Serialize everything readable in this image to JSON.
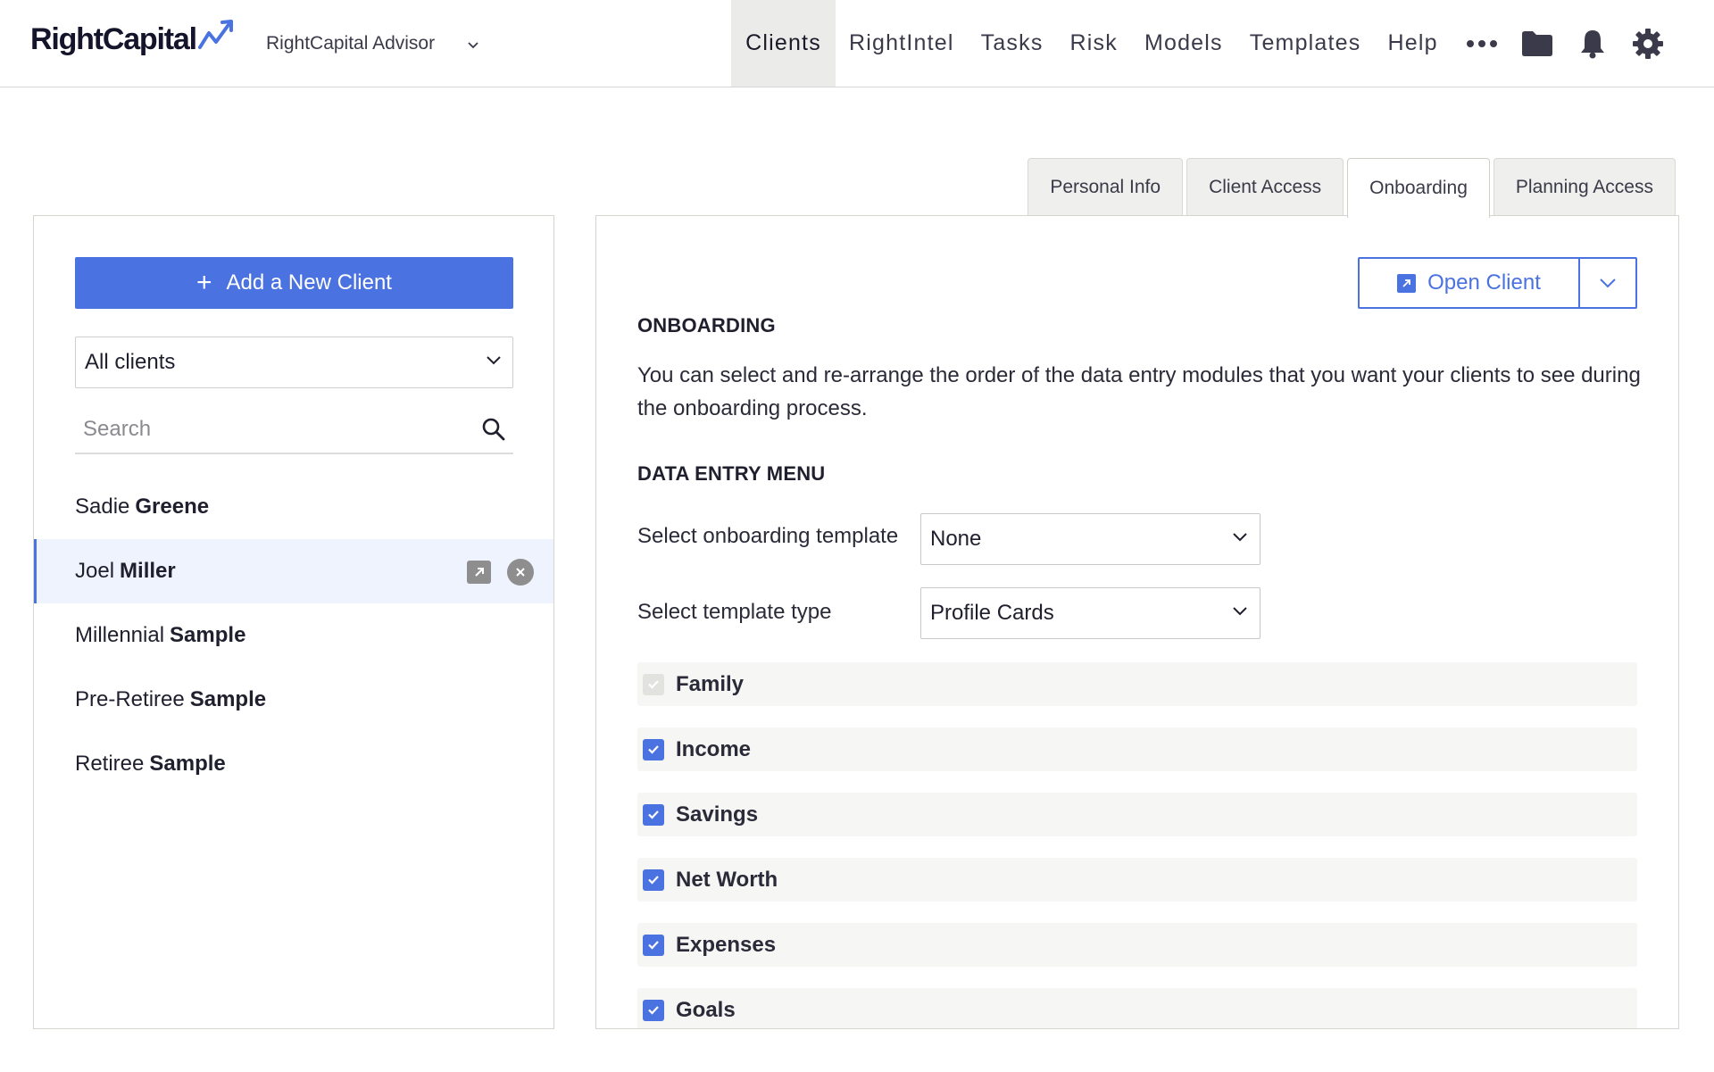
{
  "app": {
    "logo_text": "RightCapital",
    "advisor_name": "RightCapital Advisor"
  },
  "nav": {
    "items": [
      {
        "label": "Clients",
        "active": true
      },
      {
        "label": "RightIntel",
        "active": false
      },
      {
        "label": "Tasks",
        "active": false
      },
      {
        "label": "Risk",
        "active": false
      },
      {
        "label": "Models",
        "active": false
      },
      {
        "label": "Templates",
        "active": false
      },
      {
        "label": "Help",
        "active": false
      }
    ],
    "icons": [
      "more-icon",
      "folder-icon",
      "bell-icon",
      "gear-icon"
    ]
  },
  "tabs": [
    {
      "label": "Personal Info",
      "active": false
    },
    {
      "label": "Client Access",
      "active": false
    },
    {
      "label": "Onboarding",
      "active": true
    },
    {
      "label": "Planning Access",
      "active": false
    }
  ],
  "sidebar": {
    "add_button_label": "Add a New Client",
    "filter_value": "All clients",
    "search_placeholder": "Search",
    "clients": [
      {
        "first": "Sadie",
        "last": "Greene",
        "selected": false
      },
      {
        "first": "Joel",
        "last": "Miller",
        "selected": true
      },
      {
        "first": "Millennial",
        "last": "Sample",
        "selected": false
      },
      {
        "first": "Pre-Retiree",
        "last": "Sample",
        "selected": false
      },
      {
        "first": "Retiree",
        "last": "Sample",
        "selected": false
      }
    ]
  },
  "main": {
    "open_client_label": "Open Client",
    "onboarding_heading": "ONBOARDING",
    "onboarding_description": "You can select and re-arrange the order of the data entry modules that you want your clients to see during the onboarding process.",
    "data_entry_heading": "DATA ENTRY MENU",
    "template_label": "Select onboarding template",
    "template_value": "None",
    "template_type_label": "Select template type",
    "template_type_value": "Profile Cards",
    "modules": [
      {
        "label": "Family",
        "checked": true,
        "disabled": true
      },
      {
        "label": "Income",
        "checked": true,
        "disabled": false
      },
      {
        "label": "Savings",
        "checked": true,
        "disabled": false
      },
      {
        "label": "Net Worth",
        "checked": true,
        "disabled": false
      },
      {
        "label": "Expenses",
        "checked": true,
        "disabled": false
      },
      {
        "label": "Goals",
        "checked": true,
        "disabled": false
      }
    ]
  },
  "colors": {
    "accent": "#4a72e0",
    "active_nav_bg": "#ebebea",
    "selected_row_bg": "#eef3fd",
    "module_bg": "#f6f6f4"
  }
}
